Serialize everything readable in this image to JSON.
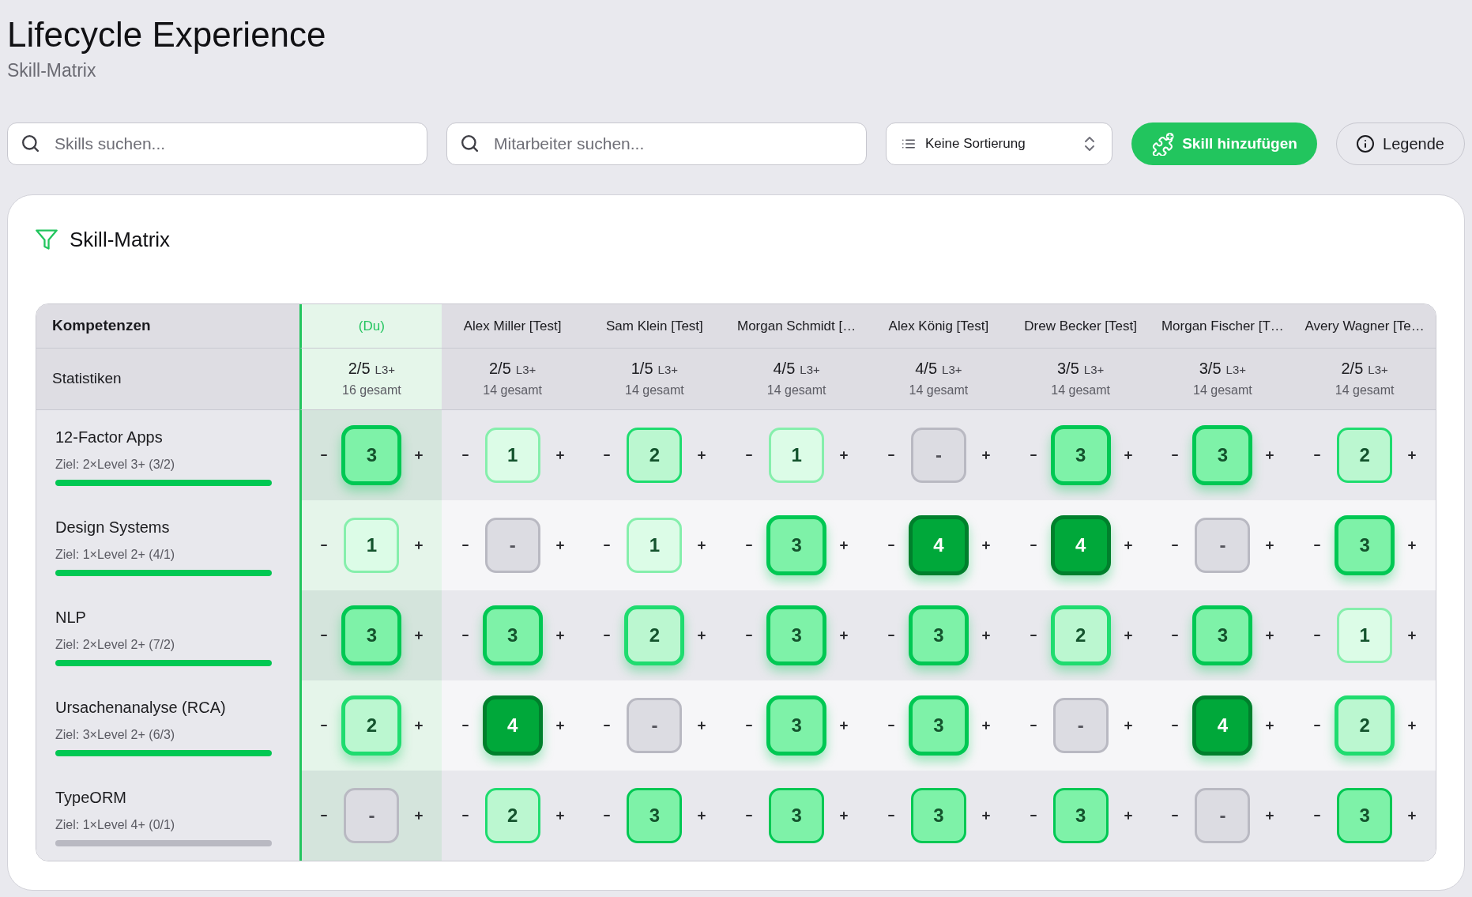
{
  "header": {
    "title": "Lifecycle Experience",
    "subtitle": "Skill-Matrix"
  },
  "toolbar": {
    "skill_search": {
      "placeholder": "Skills suchen..."
    },
    "employee_search": {
      "placeholder": "Mitarbeiter suchen..."
    },
    "sort_select": {
      "value": "Keine Sortierung"
    },
    "add_button": {
      "label": "Skill hinzufügen"
    },
    "legend_button": {
      "label": "Legende"
    }
  },
  "matrix": {
    "title": "Skill-Matrix",
    "corner_label": "Kompetenzen",
    "stats_label": "Statistiken",
    "columns": [
      {
        "name": "(Du)",
        "current": true,
        "ratio": "2/5",
        "threshold": "L3+",
        "total": "16 gesamt"
      },
      {
        "name": "Alex Miller [Test]",
        "current": false,
        "ratio": "2/5",
        "threshold": "L3+",
        "total": "14 gesamt"
      },
      {
        "name": "Sam Klein [Test]",
        "current": false,
        "ratio": "1/5",
        "threshold": "L3+",
        "total": "14 gesamt"
      },
      {
        "name": "Morgan Schmidt […",
        "current": false,
        "ratio": "4/5",
        "threshold": "L3+",
        "total": "14 gesamt"
      },
      {
        "name": "Alex König [Test]",
        "current": false,
        "ratio": "4/5",
        "threshold": "L3+",
        "total": "14 gesamt"
      },
      {
        "name": "Drew Becker [Test]",
        "current": false,
        "ratio": "3/5",
        "threshold": "L3+",
        "total": "14 gesamt"
      },
      {
        "name": "Morgan Fischer [T…",
        "current": false,
        "ratio": "3/5",
        "threshold": "L3+",
        "total": "14 gesamt"
      },
      {
        "name": "Avery Wagner [Te…",
        "current": false,
        "ratio": "2/5",
        "threshold": "L3+",
        "total": "14 gesamt"
      }
    ],
    "rows": [
      {
        "skill": "12-Factor Apps",
        "goal": "Ziel: 2×Level 3+ (3/2)",
        "level": 1,
        "cells": [
          {
            "value": "3",
            "kind": "strong",
            "meets_goal": true
          },
          {
            "value": "1",
            "kind": "light",
            "meets_goal": false
          },
          {
            "value": "2",
            "kind": "medium",
            "meets_goal": false
          },
          {
            "value": "1",
            "kind": "light",
            "meets_goal": false
          },
          {
            "value": "-",
            "kind": "empty",
            "meets_goal": false
          },
          {
            "value": "3",
            "kind": "strong",
            "meets_goal": true
          },
          {
            "value": "3",
            "kind": "strong",
            "meets_goal": true
          },
          {
            "value": "2",
            "kind": "medium",
            "meets_goal": false
          }
        ]
      },
      {
        "skill": "Design Systems",
        "goal": "Ziel: 1×Level 2+ (4/1)",
        "level": 1,
        "cells": [
          {
            "value": "1",
            "kind": "light",
            "meets_goal": false
          },
          {
            "value": "-",
            "kind": "empty",
            "meets_goal": false
          },
          {
            "value": "1",
            "kind": "light",
            "meets_goal": false
          },
          {
            "value": "3",
            "kind": "strong",
            "meets_goal": true
          },
          {
            "value": "4",
            "kind": "dark",
            "meets_goal": true
          },
          {
            "value": "4",
            "kind": "dark",
            "meets_goal": true
          },
          {
            "value": "-",
            "kind": "empty",
            "meets_goal": false
          },
          {
            "value": "3",
            "kind": "strong",
            "meets_goal": true
          }
        ]
      },
      {
        "skill": "NLP",
        "goal": "Ziel: 2×Level 2+ (7/2)",
        "level": 1,
        "cells": [
          {
            "value": "3",
            "kind": "strong",
            "meets_goal": true
          },
          {
            "value": "3",
            "kind": "strong",
            "meets_goal": true
          },
          {
            "value": "2",
            "kind": "medium",
            "meets_goal": true
          },
          {
            "value": "3",
            "kind": "strong",
            "meets_goal": true
          },
          {
            "value": "3",
            "kind": "strong",
            "meets_goal": true
          },
          {
            "value": "2",
            "kind": "medium",
            "meets_goal": true
          },
          {
            "value": "3",
            "kind": "strong",
            "meets_goal": true
          },
          {
            "value": "1",
            "kind": "light",
            "meets_goal": false
          }
        ]
      },
      {
        "skill": "Ursachenanalyse (RCA)",
        "goal": "Ziel: 3×Level 2+ (6/3)",
        "level": 1,
        "cells": [
          {
            "value": "2",
            "kind": "medium",
            "meets_goal": true
          },
          {
            "value": "4",
            "kind": "dark",
            "meets_goal": true
          },
          {
            "value": "-",
            "kind": "empty",
            "meets_goal": false
          },
          {
            "value": "3",
            "kind": "strong",
            "meets_goal": true
          },
          {
            "value": "3",
            "kind": "strong",
            "meets_goal": true
          },
          {
            "value": "-",
            "kind": "empty",
            "meets_goal": false
          },
          {
            "value": "4",
            "kind": "dark",
            "meets_goal": true
          },
          {
            "value": "2",
            "kind": "medium",
            "meets_goal": true
          }
        ]
      },
      {
        "skill": "TypeORM",
        "goal": "Ziel: 1×Level 4+ (0/1)",
        "level": 0,
        "cells": [
          {
            "value": "-",
            "kind": "empty",
            "meets_goal": false
          },
          {
            "value": "2",
            "kind": "medium",
            "meets_goal": false
          },
          {
            "value": "3",
            "kind": "strong",
            "meets_goal": false
          },
          {
            "value": "3",
            "kind": "strong",
            "meets_goal": false
          },
          {
            "value": "3",
            "kind": "strong",
            "meets_goal": false
          },
          {
            "value": "3",
            "kind": "strong",
            "meets_goal": false
          },
          {
            "value": "-",
            "kind": "empty",
            "meets_goal": false
          },
          {
            "value": "3",
            "kind": "strong",
            "meets_goal": false
          }
        ]
      }
    ]
  }
}
